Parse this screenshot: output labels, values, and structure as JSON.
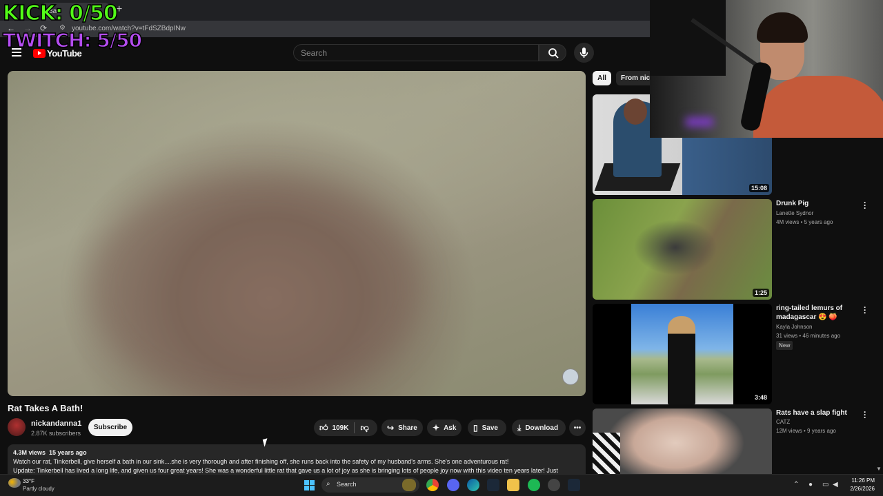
{
  "browser": {
    "tab_title": "Bat",
    "new_tab": "+",
    "back": "←",
    "forward": "→",
    "reload": "⟳",
    "url": "youtube.com/watch?v=tFdSZBdpINw"
  },
  "overlays": {
    "kick": "KICK: 0/50",
    "twitch": "TWITCH: 5/50"
  },
  "masthead": {
    "logo_text": "YouTube",
    "search_placeholder": "Search"
  },
  "video": {
    "title": "Rat Takes A Bath!",
    "channel": "nickandanna1",
    "subscribers": "2.87K subscribers",
    "subscribe_label": "Subscribe",
    "likes": "109K",
    "share_label": "Share",
    "ask_label": "Ask",
    "save_label": "Save",
    "download_label": "Download",
    "views": "4.3M views",
    "age": "15 years ago",
    "description_line1": "Watch our rat, Tinkerbell, give herself a bath in our sink....she is very thorough and after finishing off, she runs back into the safety of my husband's arms. She's one adventurous rat!",
    "description_line2": "Update: Tinkerbell has lived a long life, and given us four great years! She was a wonderful little rat that gave us a lot of joy as she is bringing lots of people joy now with this video ten years later! Just"
  },
  "chips": [
    {
      "label": "All",
      "active": true
    },
    {
      "label": "From nickandanna1",
      "active": false
    }
  ],
  "recommendations": [
    {
      "duration": "15:08",
      "title": "",
      "channel": "",
      "meta": ""
    },
    {
      "duration": "1:25",
      "title": "Drunk Pig",
      "channel": "Lanette Sydnor",
      "meta": "4M views • 5 years ago"
    },
    {
      "duration": "3:48",
      "title": "ring-tailed lemurs of madagascar 😍 🍑",
      "channel": "Kayla Johnson",
      "meta": "31 views • 46 minutes ago",
      "badge": "New"
    },
    {
      "duration": "",
      "title": "Rats have a slap fight",
      "channel": "CATZ",
      "meta": "12M views • 9 years ago"
    }
  ],
  "taskbar": {
    "temperature": "33°F",
    "condition": "Partly cloudy",
    "search_label": "Search",
    "time": "11:26 PM",
    "date": "2/26/2026"
  },
  "colors": {
    "background": "#0f0f0f",
    "kick_green": "#53fc18",
    "twitch_purple": "#b44df0",
    "youtube_red": "#ff0000"
  }
}
